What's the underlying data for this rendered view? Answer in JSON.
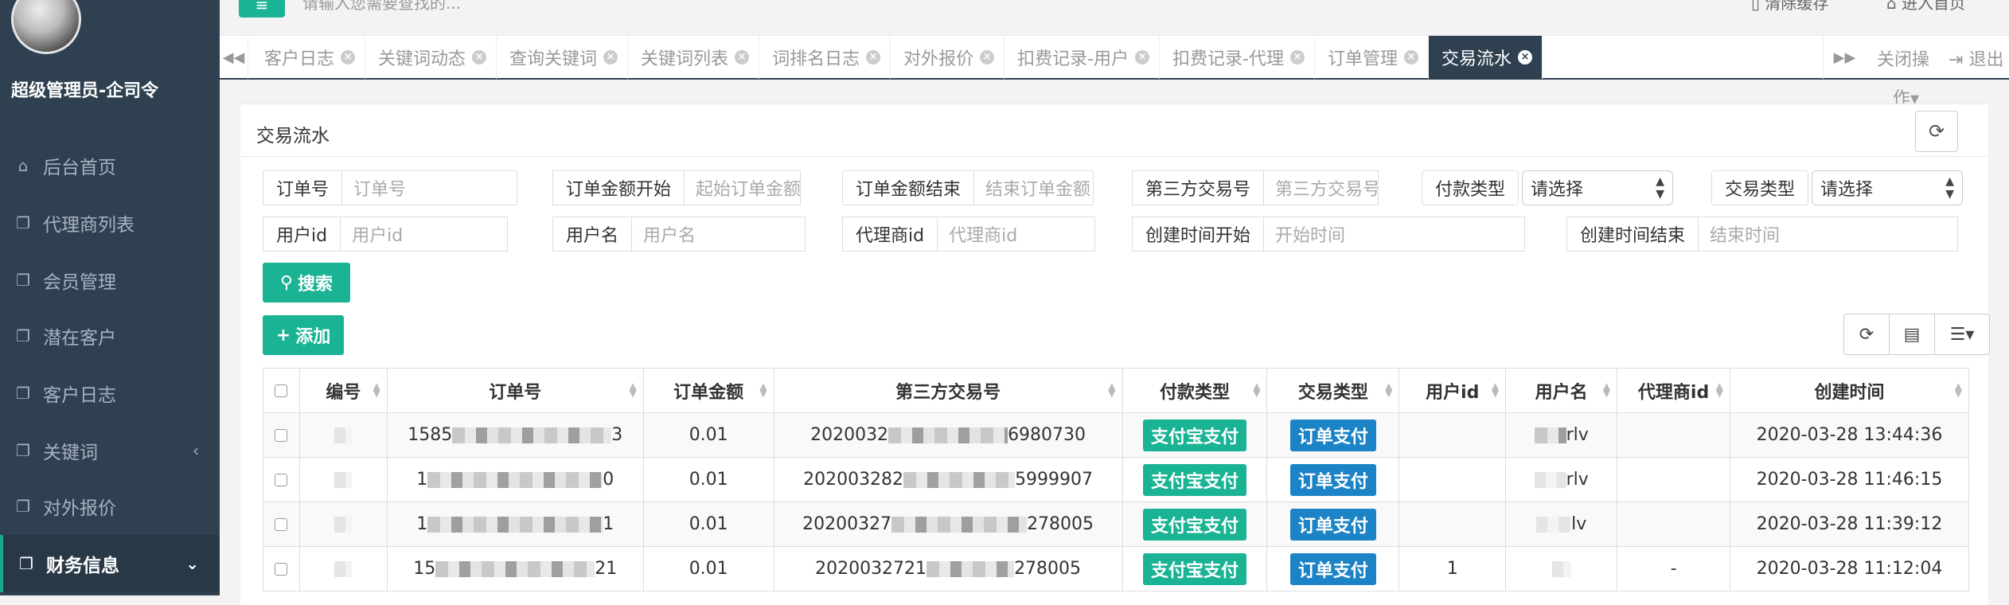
{
  "sidebar": {
    "admin_name": "超级管理员-企司令",
    "items": [
      {
        "label": "后台首页",
        "icon": "home-icon"
      },
      {
        "label": "代理商列表",
        "icon": "copy-icon"
      },
      {
        "label": "会员管理",
        "icon": "copy-icon"
      },
      {
        "label": "潜在客户",
        "icon": "copy-icon"
      },
      {
        "label": "客户日志",
        "icon": "copy-icon"
      },
      {
        "label": "关键词",
        "icon": "copy-icon",
        "chevron": "‹"
      },
      {
        "label": "对外报价",
        "icon": "copy-icon"
      },
      {
        "label": "财务信息",
        "icon": "copy-icon",
        "chevron": "⌄",
        "active": true
      }
    ]
  },
  "topbar": {
    "search_hint": "请输入您需要查找的...",
    "clear_cache": "清除缓存",
    "go_home": "进入首页"
  },
  "tabs": [
    {
      "label": "客户日志"
    },
    {
      "label": "关键词动态"
    },
    {
      "label": "查询关键词"
    },
    {
      "label": "关键词列表"
    },
    {
      "label": "词排名日志"
    },
    {
      "label": "对外报价"
    },
    {
      "label": "扣费记录-用户"
    },
    {
      "label": "扣费记录-代理"
    },
    {
      "label": "订单管理"
    },
    {
      "label": "交易流水",
      "active": true
    }
  ],
  "tab_actions": {
    "close_ops_1": "关闭操",
    "close_ops_2": "作",
    "logout": "退出"
  },
  "panel": {
    "title": "交易流水"
  },
  "filters": {
    "order_no": {
      "label": "订单号",
      "placeholder": "订单号"
    },
    "amount_start": {
      "label": "订单金额开始",
      "placeholder": "起始订单金额"
    },
    "amount_end": {
      "label": "订单金额结束",
      "placeholder": "结束订单金额"
    },
    "third_party_no": {
      "label": "第三方交易号",
      "placeholder": "第三方交易号"
    },
    "pay_type": {
      "label": "付款类型",
      "value": "请选择"
    },
    "trade_type": {
      "label": "交易类型",
      "value": "请选择"
    },
    "user_id": {
      "label": "用户id",
      "placeholder": "用户id"
    },
    "username": {
      "label": "用户名",
      "placeholder": "用户名"
    },
    "agent_id": {
      "label": "代理商id",
      "placeholder": "代理商id"
    },
    "created_start": {
      "label": "创建时间开始",
      "placeholder": "开始时间"
    },
    "created_end": {
      "label": "创建时间结束",
      "placeholder": "结束时间"
    }
  },
  "buttons": {
    "search": "搜索",
    "add": "添加"
  },
  "table": {
    "headers": [
      "编号",
      "订单号",
      "订单金额",
      "第三方交易号",
      "付款类型",
      "交易类型",
      "用户id",
      "用户名",
      "代理商id",
      "创建时间"
    ],
    "rows": [
      {
        "order_prefix": "1585",
        "order_suffix": "3",
        "amount": "0.01",
        "tp_prefix": "2020032",
        "tp_suffix": "6980730",
        "pay_type": "支付宝支付",
        "trade_type": "订单支付",
        "user_id": "",
        "username": "rlv",
        "agent_id": "",
        "created": "2020-03-28 13:44:36"
      },
      {
        "order_prefix": "1",
        "order_suffix": "0",
        "amount": "0.01",
        "tp_prefix": "202003282",
        "tp_suffix": "5999907",
        "pay_type": "支付宝支付",
        "trade_type": "订单支付",
        "user_id": "",
        "username": "rlv",
        "agent_id": "",
        "created": "2020-03-28 11:46:15"
      },
      {
        "order_prefix": "1",
        "order_suffix": "1",
        "amount": "0.01",
        "tp_prefix": "20200327",
        "tp_suffix": "278005",
        "pay_type": "支付宝支付",
        "trade_type": "订单支付",
        "user_id": "",
        "username": "lv",
        "agent_id": "",
        "created": "2020-03-28 11:39:12"
      },
      {
        "order_prefix": "15",
        "order_suffix": "21",
        "amount": "0.01",
        "tp_prefix": "2020032721",
        "tp_suffix": "278005",
        "pay_type": "支付宝支付",
        "trade_type": "订单支付",
        "user_id": "1",
        "username": "",
        "agent_id": "-",
        "created": "2020-03-28 11:12:04"
      }
    ]
  },
  "colors": {
    "sidebar": "#2f4050",
    "primary": "#1ab394",
    "info": "#1c84c6"
  }
}
